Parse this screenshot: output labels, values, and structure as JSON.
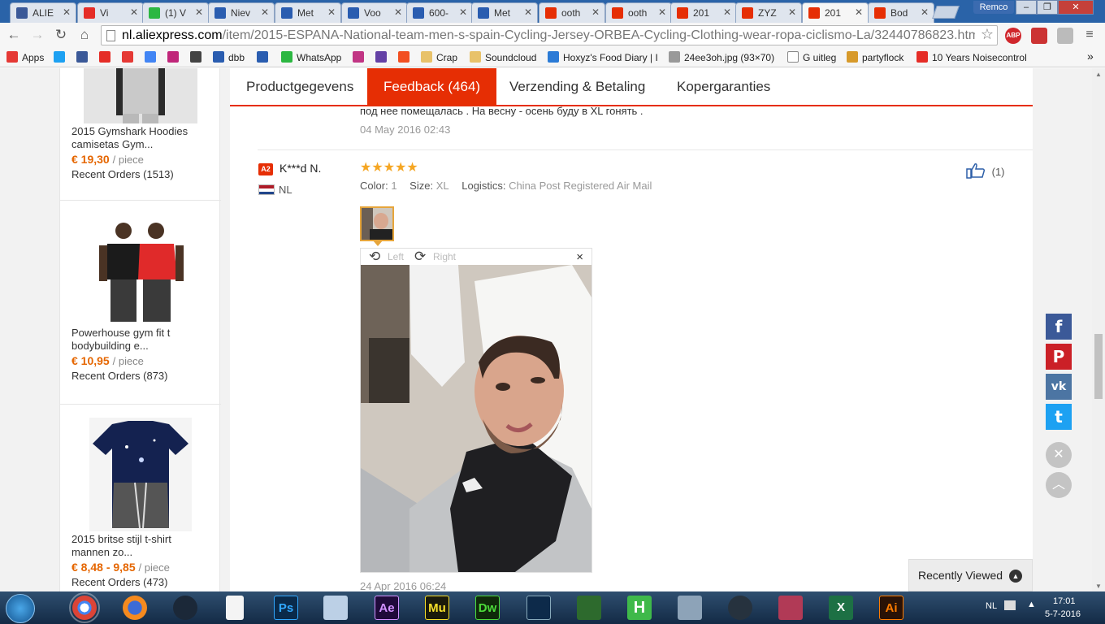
{
  "browser": {
    "tabs": [
      {
        "label": "ALIE",
        "color": "#3b5998"
      },
      {
        "label": "Vi",
        "color": "#e52d27"
      },
      {
        "label": "(1) V",
        "color": "#2cb742"
      },
      {
        "label": "Niev",
        "color": "#2a5db0"
      },
      {
        "label": "Met",
        "color": "#2a5db0"
      },
      {
        "label": "Voo",
        "color": "#2a5db0"
      },
      {
        "label": "600-",
        "color": "#2a5db0"
      },
      {
        "label": "Met",
        "color": "#2a5db0"
      },
      {
        "label": "ooth",
        "color": "#e62e04"
      },
      {
        "label": "ooth",
        "color": "#e62e04"
      },
      {
        "label": "201",
        "color": "#e62e04"
      },
      {
        "label": "ZYZ",
        "color": "#e62e04"
      },
      {
        "label": "201",
        "color": "#e62e04",
        "active": true
      },
      {
        "label": "Bod",
        "color": "#e62e04"
      }
    ],
    "profile_name": "Remco",
    "url_domain": "nl.aliexpress.com",
    "url_path": "/item/2015-ESPANA-National-team-men-s-spain-Cycling-Jersey-ORBEA-Cycling-Clothing-wear-ropa-ciclismo-La/32440786823.html?",
    "abp_label": "ABP"
  },
  "bookmarks": [
    {
      "label": "Apps",
      "color": "#e53935"
    },
    {
      "label": "",
      "color": "#1da1f2"
    },
    {
      "label": "",
      "color": "#3b5998"
    },
    {
      "label": "",
      "color": "#e52d27"
    },
    {
      "label": "",
      "color": "#e53935"
    },
    {
      "label": "",
      "color": "#4285f4"
    },
    {
      "label": "",
      "color": "#c0267a"
    },
    {
      "label": "",
      "color": "#444444"
    },
    {
      "label": "dbb",
      "color": "#2a5db0"
    },
    {
      "label": "",
      "color": "#2a5db0"
    },
    {
      "label": "WhatsApp",
      "color": "#2cb742"
    },
    {
      "label": "",
      "color": "#c13584"
    },
    {
      "label": "",
      "color": "#6441a5"
    },
    {
      "label": "",
      "color": "#f25022"
    },
    {
      "label": "Crap",
      "color": "#e8c26a"
    },
    {
      "label": "Soundcloud",
      "color": "#e8c26a"
    },
    {
      "label": "Hoxyz's Food Diary | I",
      "color": "#2b7bd6"
    },
    {
      "label": "24ee3oh.jpg (93×70)",
      "color": "#999999"
    },
    {
      "label": "G uitleg",
      "color": "#ffffff"
    },
    {
      "label": "partyflock",
      "color": "#d79a2b"
    },
    {
      "label": "10 Years Noisecontrol",
      "color": "#e52d27"
    }
  ],
  "sidebar": {
    "products": [
      {
        "name": "2015 Gymshark Hoodies camisetas Gym...",
        "price": "€ 19,30",
        "unit": "/ piece",
        "orders": "Recent Orders (1513)"
      },
      {
        "name": "Powerhouse gym fit t bodybuilding e...",
        "price": "€ 10,95",
        "unit": "/ piece",
        "orders": "Recent Orders (873)"
      },
      {
        "name": "2015 britse stijl t-shirt mannen zo...",
        "price": "€ 8,48 - 9,85",
        "unit": "/ piece",
        "orders": "Recent Orders (473)"
      }
    ]
  },
  "tabs": [
    {
      "label": "Productgegevens"
    },
    {
      "label": "Feedback (464)",
      "active": true
    },
    {
      "label": "Verzending & Betaling"
    },
    {
      "label": "Kopergaranties"
    }
  ],
  "prev_review": {
    "text": "под нее помещалась . На весну - осень буду в XL гонять .",
    "date": "04 May 2016 02:43"
  },
  "review": {
    "level": "A2",
    "user": "K***d N.",
    "country": "NL",
    "stars": "★★★★★",
    "rating": 5,
    "color_label": "Color:",
    "color_value": "1",
    "size_label": "Size:",
    "size_value": "XL",
    "logistics_label": "Logistics:",
    "logistics_value": "China Post Registered Air Mail",
    "helpful_count": "(1)",
    "viewer": {
      "left_label": "Left",
      "right_label": "Right",
      "close": "×"
    },
    "date": "24 Apr 2016 06:24"
  },
  "share": [
    {
      "name": "facebook",
      "glyph": "f",
      "color": "#3b5998"
    },
    {
      "name": "pinterest",
      "glyph": "P",
      "color": "#cb2027"
    },
    {
      "name": "vk",
      "glyph": "vk",
      "color": "#4c75a3"
    },
    {
      "name": "twitter",
      "glyph": "t",
      "color": "#1da1f2"
    }
  ],
  "recently_viewed": "Recently Viewed",
  "taskbar": {
    "apps": [
      "chrome",
      "firefox",
      "steam",
      "file",
      "photoshop",
      "keyboard",
      "after-effects",
      "muse",
      "dreamweaver",
      "video",
      "excel-like",
      "h-app",
      "monitor",
      "recycle",
      "spider",
      "excel",
      "illustrator"
    ],
    "ps": "Ps",
    "ae": "Ae",
    "mu": "Mu",
    "dw": "Dw",
    "ai": "Ai",
    "h": "H",
    "lang": "NL",
    "time": "17:01",
    "date": "5-7-2016"
  }
}
